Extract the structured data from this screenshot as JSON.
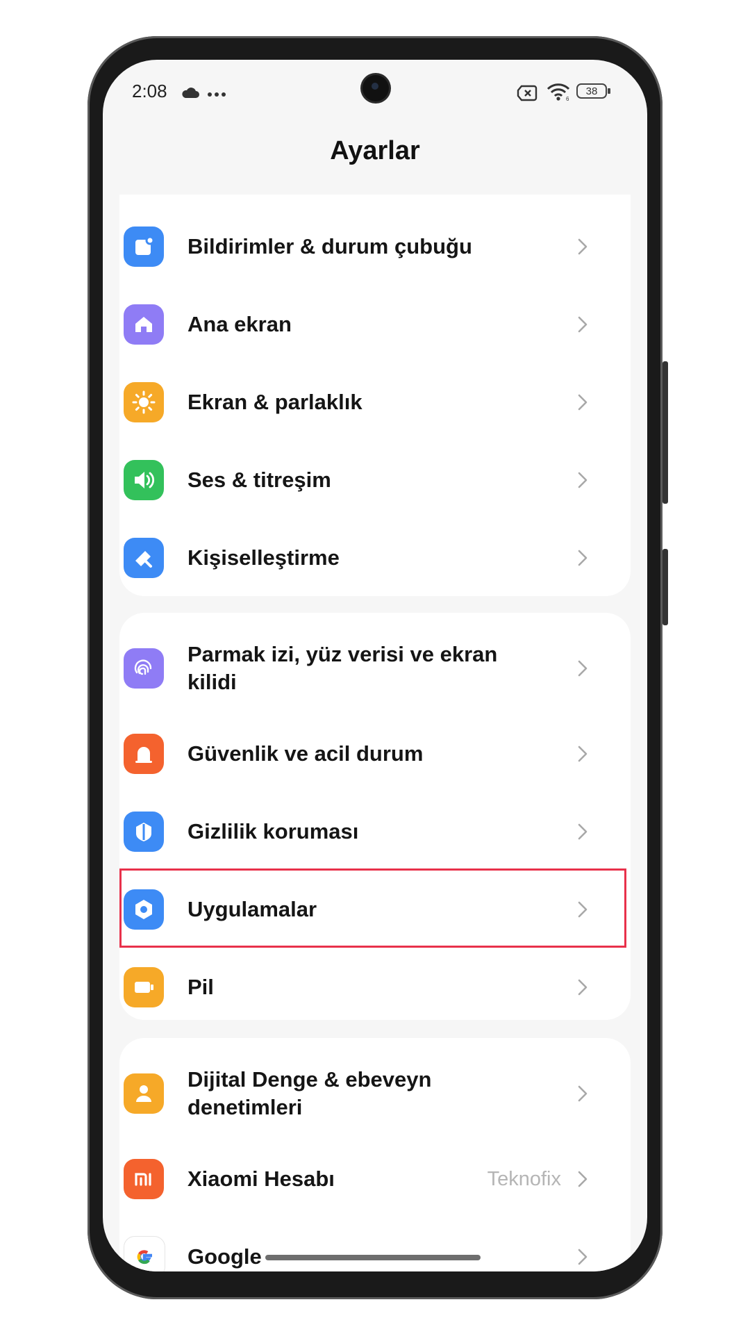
{
  "status_bar": {
    "time": "2:08",
    "battery": "38",
    "icons": [
      "cloud-icon",
      "more-dots-icon",
      "no-sim-icon",
      "wifi-icon",
      "battery-icon"
    ]
  },
  "page": {
    "title": "Ayarlar"
  },
  "groups": [
    {
      "items": [
        {
          "label": "Bildirimler & durum çubuğu",
          "icon": "notification-icon",
          "color": "#3d8bf5"
        },
        {
          "label": "Ana ekran",
          "icon": "home-icon",
          "color": "#8f7cf5"
        },
        {
          "label": "Ekran & parlaklık",
          "icon": "sun-icon",
          "color": "#f6a928"
        },
        {
          "label": "Ses & titreşim",
          "icon": "speaker-icon",
          "color": "#33c15b"
        },
        {
          "label": "Kişiselleştirme",
          "icon": "brush-icon",
          "color": "#3d8bf5"
        }
      ]
    },
    {
      "items": [
        {
          "label": "Parmak izi, yüz verisi ve ekran kilidi",
          "icon": "fingerprint-icon",
          "color": "#8f7cf5"
        },
        {
          "label": "Güvenlik ve acil durum",
          "icon": "alarm-icon",
          "color": "#f4622e"
        },
        {
          "label": "Gizlilik koruması",
          "icon": "shield-icon",
          "color": "#3d8bf5"
        },
        {
          "label": "Uygulamalar",
          "icon": "apps-gear-icon",
          "color": "#3d8bf5",
          "highlighted": true
        },
        {
          "label": "Pil",
          "icon": "battery-app-icon",
          "color": "#f6a928"
        }
      ]
    },
    {
      "items": [
        {
          "label": "Dijital Denge & ebeveyn denetimleri",
          "icon": "digital-wellbeing-icon",
          "color": "#f6a928"
        },
        {
          "label": "Xiaomi Hesabı",
          "value": "Teknofix",
          "icon": "mi-icon",
          "color": "#f4622e"
        },
        {
          "label": "Google",
          "icon": "google-icon",
          "color": "#ffffff"
        }
      ]
    }
  ],
  "colors": {
    "highlight": "#e8314b",
    "chevron": "#a8a8a8"
  }
}
